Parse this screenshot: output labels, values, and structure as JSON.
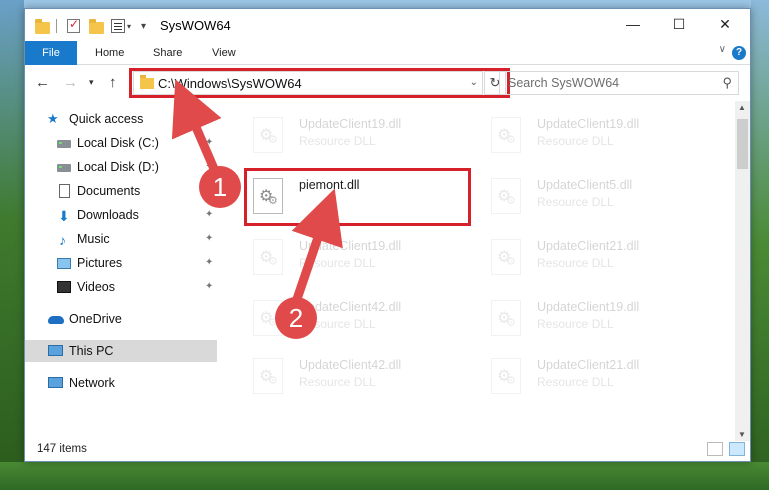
{
  "window": {
    "title": "SysWOW64",
    "controls": {
      "minimize": "—",
      "maximize": "☐",
      "close": "✕"
    }
  },
  "ribbon": {
    "tabs": [
      "File",
      "Home",
      "Share",
      "View"
    ],
    "help": "?"
  },
  "address": {
    "path": "C:\\Windows\\SysWOW64",
    "search_placeholder": "Search SysWOW64"
  },
  "sidebar": {
    "items": [
      {
        "label": "Quick access",
        "icon": "star-icon"
      },
      {
        "label": "Local Disk (C:)",
        "icon": "drive-icon",
        "pinned": true
      },
      {
        "label": "Local Disk (D:)",
        "icon": "drive-icon",
        "pinned": true
      },
      {
        "label": "Documents",
        "icon": "documents-icon",
        "pinned": true
      },
      {
        "label": "Downloads",
        "icon": "download-icon",
        "pinned": true
      },
      {
        "label": "Music",
        "icon": "music-icon",
        "pinned": true
      },
      {
        "label": "Pictures",
        "icon": "pictures-icon",
        "pinned": true
      },
      {
        "label": "Videos",
        "icon": "videos-icon",
        "pinned": true
      },
      {
        "label": "OneDrive",
        "icon": "onedrive-icon"
      },
      {
        "label": "This PC",
        "icon": "this-pc-icon",
        "selected": true
      },
      {
        "label": "Network",
        "icon": "network-icon"
      }
    ]
  },
  "files": {
    "highlighted": {
      "name": "piemont.dll",
      "type": ""
    },
    "background": [
      {
        "name": "UpdateClient19.dll",
        "type": "Resource DLL"
      },
      {
        "name": "UpdateClient19.dll",
        "type": "Resource DLL"
      },
      {
        "name": "UpdateClient5.dll",
        "type": "Resource DLL"
      },
      {
        "name": "UpdateClient19.dll",
        "type": "Resource DLL"
      },
      {
        "name": "UpdateClient21.dll",
        "type": "Resource DLL"
      },
      {
        "name": "UpdateClient42.dll",
        "type": "Resource DLL"
      },
      {
        "name": "UpdateClient19.dll",
        "type": "Resource DLL"
      },
      {
        "name": "UpdateClient42.dll",
        "type": "Resource DLL"
      },
      {
        "name": "UpdateClient21.dll",
        "type": "Resource DLL"
      }
    ]
  },
  "status": {
    "item_count": "147 items"
  },
  "annotations": {
    "step1": "1",
    "step2": "2"
  },
  "colors": {
    "accent": "#1979ca",
    "highlight": "#d6202a"
  }
}
